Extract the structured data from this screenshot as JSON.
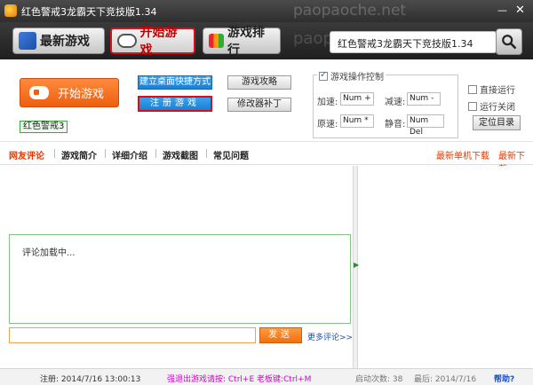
{
  "window": {
    "title": "红色警戒3龙霸天下竞技版1.34",
    "watermark": "paopaoche.net",
    "minimize_label": "—",
    "close_label": "✕"
  },
  "toolbar": {
    "new_games": "最新游戏",
    "start_game": "开始游戏",
    "ranking": "游戏排行",
    "search_value": "红色警戒3龙霸天下竞技版1.34",
    "search_icon": "magnifier-icon"
  },
  "controls": {
    "start_label": "开始游戏",
    "game_tag": "红色警戒3",
    "desktop_shortcut": "建立桌面快捷方式",
    "register_game": "注册游戏",
    "guide": "游戏攻略",
    "patch": "修改器补丁",
    "ops_title": "游戏操作控制",
    "speed_up_label": "加速:",
    "speed_up_key": "Num +",
    "slow_down_label": "减速:",
    "slow_down_key": "Num -",
    "normal_label": "原速:",
    "normal_key": "Num *",
    "mute_label": "静音:",
    "mute_key": "Num Del",
    "direct_run": "直接运行",
    "run_close": "运行关闭",
    "locate_dir": "定位目录"
  },
  "tabs": {
    "items": [
      "网友评论",
      "游戏简介",
      "详细介绍",
      "游戏截图",
      "常见问题"
    ],
    "active_index": 0,
    "link_single": "最新单机下载",
    "link_new": "最新下载"
  },
  "comments": {
    "loading": "评论加载中...",
    "send": "发送",
    "more": "更多评论>>"
  },
  "status": {
    "register": "注册: 2014/7/16 13:00:13",
    "hotkey": "强退出游戏请按: Ctrl+E 老板键:Ctrl+M",
    "launch_count": "启动次数: 38",
    "last": "最后: 2014/7/16",
    "help": "帮助?"
  },
  "colors": {
    "accent_orange": "#ee5f10",
    "highlight_red": "#d8101c",
    "link_blue": "#1a4fc0",
    "tab_active": "#e03a00"
  }
}
